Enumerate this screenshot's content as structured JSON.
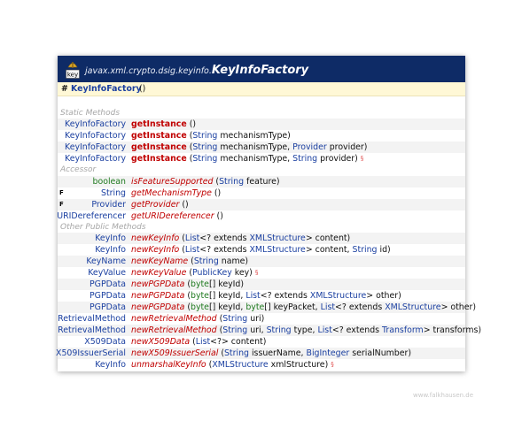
{
  "header": {
    "icon_label": "key",
    "package": "javax.xml.crypto.dsig.keyinfo.",
    "class_name": "KeyInfoFactory"
  },
  "constructor": {
    "marker": "#",
    "name": "KeyInfoFactory",
    "args": "()"
  },
  "sections": {
    "static": "Static Methods",
    "accessor": "Accessor",
    "other": "Other Public Methods"
  },
  "static_methods": [
    {
      "ret": "KeyInfoFactory",
      "name": "getInstance",
      "params": [
        {
          "t": "()"
        }
      ]
    },
    {
      "ret": "KeyInfoFactory",
      "name": "getInstance",
      "params": [
        {
          "t": "("
        },
        {
          "t": "String",
          "k": "type"
        },
        {
          "t": " mechanismType)"
        }
      ]
    },
    {
      "ret": "KeyInfoFactory",
      "name": "getInstance",
      "params": [
        {
          "t": "("
        },
        {
          "t": "String",
          "k": "type"
        },
        {
          "t": " mechanismType, "
        },
        {
          "t": "Provider",
          "k": "type"
        },
        {
          "t": " provider)"
        }
      ]
    },
    {
      "ret": "KeyInfoFactory",
      "name": "getInstance",
      "params": [
        {
          "t": "("
        },
        {
          "t": "String",
          "k": "type"
        },
        {
          "t": " mechanismType, "
        },
        {
          "t": "String",
          "k": "type"
        },
        {
          "t": " provider)"
        }
      ],
      "note": "§"
    }
  ],
  "accessors": [
    {
      "ret": "boolean",
      "ret_style": "primitive",
      "name": "isFeatureSupported",
      "params": [
        {
          "t": "("
        },
        {
          "t": "String",
          "k": "type"
        },
        {
          "t": " feature)"
        }
      ]
    },
    {
      "mark": "F",
      "ret": "String",
      "name": "getMechanismType",
      "params": [
        {
          "t": "()"
        }
      ]
    },
    {
      "mark": "F",
      "ret": "Provider",
      "name": "getProvider",
      "params": [
        {
          "t": "()"
        }
      ]
    },
    {
      "ret": "URIDereferencer",
      "name": "getURIDereferencer",
      "params": [
        {
          "t": "()"
        }
      ]
    }
  ],
  "other_methods": [
    {
      "ret": "KeyInfo",
      "name": "newKeyInfo",
      "params": [
        {
          "t": "("
        },
        {
          "t": "List",
          "k": "type"
        },
        {
          "t": "<? extends "
        },
        {
          "t": "XMLStructure",
          "k": "type"
        },
        {
          "t": "> content)"
        }
      ]
    },
    {
      "ret": "KeyInfo",
      "name": "newKeyInfo",
      "params": [
        {
          "t": "("
        },
        {
          "t": "List",
          "k": "type"
        },
        {
          "t": "<? extends "
        },
        {
          "t": "XMLStructure",
          "k": "type"
        },
        {
          "t": "> content, "
        },
        {
          "t": "String",
          "k": "type"
        },
        {
          "t": " id)"
        }
      ]
    },
    {
      "ret": "KeyName",
      "name": "newKeyName",
      "params": [
        {
          "t": "("
        },
        {
          "t": "String",
          "k": "type"
        },
        {
          "t": " name)"
        }
      ]
    },
    {
      "ret": "KeyValue",
      "name": "newKeyValue",
      "params": [
        {
          "t": "("
        },
        {
          "t": "PublicKey",
          "k": "type"
        },
        {
          "t": " key)"
        }
      ],
      "note": "§"
    },
    {
      "ret": "PGPData",
      "name": "newPGPData",
      "params": [
        {
          "t": "("
        },
        {
          "t": "byte",
          "k": "prim"
        },
        {
          "t": "[] keyId)"
        }
      ]
    },
    {
      "ret": "PGPData",
      "name": "newPGPData",
      "params": [
        {
          "t": "("
        },
        {
          "t": "byte",
          "k": "prim"
        },
        {
          "t": "[] keyId, "
        },
        {
          "t": "List",
          "k": "type"
        },
        {
          "t": "<? extends "
        },
        {
          "t": "XMLStructure",
          "k": "type"
        },
        {
          "t": "> other)"
        }
      ]
    },
    {
      "ret": "PGPData",
      "name": "newPGPData",
      "params": [
        {
          "t": "("
        },
        {
          "t": "byte",
          "k": "prim"
        },
        {
          "t": "[] keyId, "
        },
        {
          "t": "byte",
          "k": "prim"
        },
        {
          "t": "[] keyPacket, "
        },
        {
          "t": "List",
          "k": "type"
        },
        {
          "t": "<? extends "
        },
        {
          "t": "XMLStructure",
          "k": "type"
        },
        {
          "t": "> other)"
        }
      ]
    },
    {
      "ret": "RetrievalMethod",
      "name": "newRetrievalMethod",
      "params": [
        {
          "t": "("
        },
        {
          "t": "String",
          "k": "type"
        },
        {
          "t": " uri)"
        }
      ]
    },
    {
      "ret": "RetrievalMethod",
      "name": "newRetrievalMethod",
      "params": [
        {
          "t": "("
        },
        {
          "t": "String",
          "k": "type"
        },
        {
          "t": " uri, "
        },
        {
          "t": "String",
          "k": "type"
        },
        {
          "t": " type, "
        },
        {
          "t": "List",
          "k": "type"
        },
        {
          "t": "<? extends "
        },
        {
          "t": "Transform",
          "k": "type"
        },
        {
          "t": "> transforms)"
        }
      ]
    },
    {
      "ret": "X509Data",
      "name": "newX509Data",
      "params": [
        {
          "t": "("
        },
        {
          "t": "List",
          "k": "type"
        },
        {
          "t": "<?> content)"
        }
      ]
    },
    {
      "ret": "X509IssuerSerial",
      "name": "newX509IssuerSerial",
      "params": [
        {
          "t": "("
        },
        {
          "t": "String",
          "k": "type"
        },
        {
          "t": " issuerName, "
        },
        {
          "t": "BigInteger",
          "k": "type"
        },
        {
          "t": " serialNumber)"
        }
      ]
    },
    {
      "ret": "KeyInfo",
      "name": "unmarshalKeyInfo",
      "params": [
        {
          "t": "("
        },
        {
          "t": "XMLStructure",
          "k": "type"
        },
        {
          "t": " xmlStructure)"
        }
      ],
      "note": "§"
    }
  ],
  "footer": "www.falkhausen.de",
  "colors": {
    "header_bg": "#0e2b66",
    "type": "#1a3fa0",
    "method": "#c00000",
    "primitive": "#1f7a1f",
    "constructor_bg": "#fff8d6",
    "section": "#a6a6a6"
  }
}
